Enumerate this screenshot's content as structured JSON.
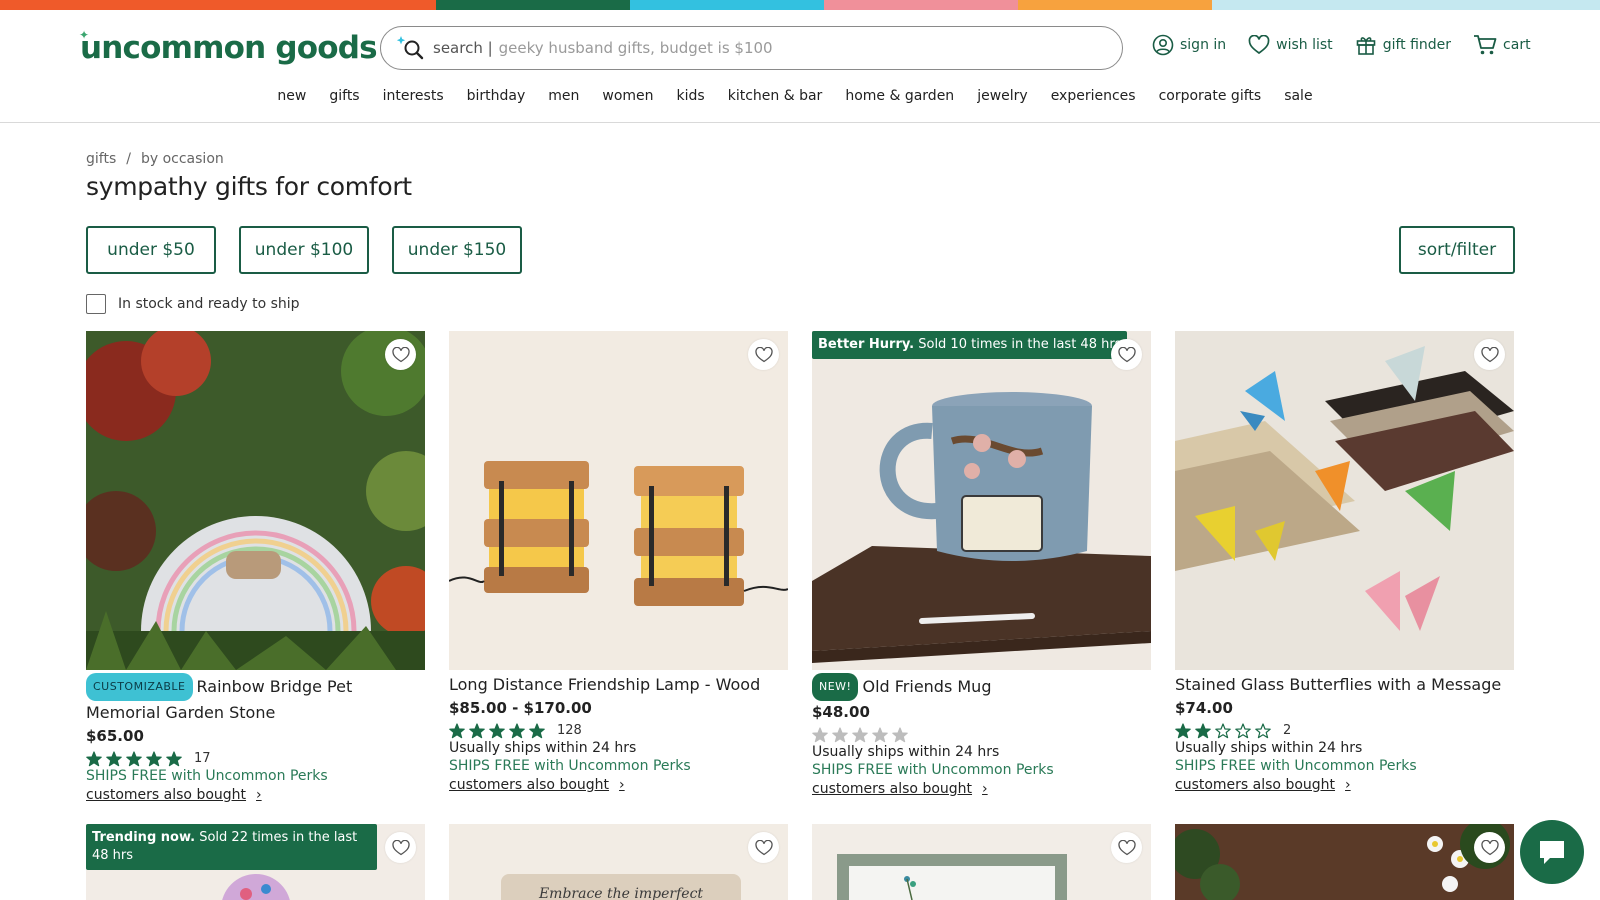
{
  "colors": {
    "brand": "#1a6b47",
    "bar": [
      "#ef5a2a",
      "#1a6b47",
      "#33c1e0",
      "#f0909a",
      "#f7a23e",
      "#c5e8f0"
    ]
  },
  "logo": {
    "text": "uncommon goods"
  },
  "search": {
    "label": "search |",
    "placeholder": "geeky husband gifts, budget is $100"
  },
  "utils": {
    "sign_in": "sign in",
    "wish_list": "wish list",
    "gift_finder": "gift finder",
    "cart": "cart"
  },
  "nav": [
    "new",
    "gifts",
    "interests",
    "birthday",
    "men",
    "women",
    "kids",
    "kitchen & bar",
    "home & garden",
    "jewelry",
    "experiences",
    "corporate gifts",
    "sale"
  ],
  "breadcrumb": {
    "item1": "gifts",
    "sep": "/",
    "item2": "by occasion"
  },
  "page_title": "sympathy gifts for comfort",
  "price_filters": [
    "under $50",
    "under $100",
    "under $150"
  ],
  "sort_filter": "sort/filter",
  "in_stock_label": "In stock and ready to ship",
  "products": [
    {
      "badge": "CUSTOMIZABLE",
      "title": "Rainbow Bridge Pet Memorial Garden Stone",
      "price": "$65.00",
      "stars": 5,
      "reviews": "17",
      "ships": "",
      "perks": "SHIPS FREE with Uncommon Perks",
      "also": "customers also bought",
      "urgency_bold": "",
      "urgency": ""
    },
    {
      "badge": "",
      "title": "Long Distance Friendship Lamp - Wood",
      "price": "$85.00 - $170.00",
      "stars": 5,
      "reviews": "128",
      "ships": "Usually ships within 24 hrs",
      "perks": "SHIPS FREE with Uncommon Perks",
      "also": "customers also bought",
      "urgency_bold": "",
      "urgency": ""
    },
    {
      "badge": "NEW!",
      "title": "Old Friends Mug",
      "price": "$48.00",
      "stars": 0,
      "reviews": "",
      "ships": "Usually ships within 24 hrs",
      "perks": "SHIPS FREE with Uncommon Perks",
      "also": "customers also bought",
      "urgency_bold": "Better Hurry.",
      "urgency": "Sold 10 times in the last 48 hrs"
    },
    {
      "badge": "",
      "title": "Stained Glass Butterflies with a Message",
      "price": "$74.00",
      "stars": 2.5,
      "reviews": "2",
      "ships": "Usually ships within 24 hrs",
      "perks": "SHIPS FREE with Uncommon Perks",
      "also": "customers also bought",
      "urgency_bold": "",
      "urgency": ""
    }
  ],
  "row2": [
    {
      "urgency_bold": "Trending now.",
      "urgency": "Sold 22 times in the last 48 hrs"
    },
    {
      "image_text": "Embrace the imperfect"
    }
  ]
}
